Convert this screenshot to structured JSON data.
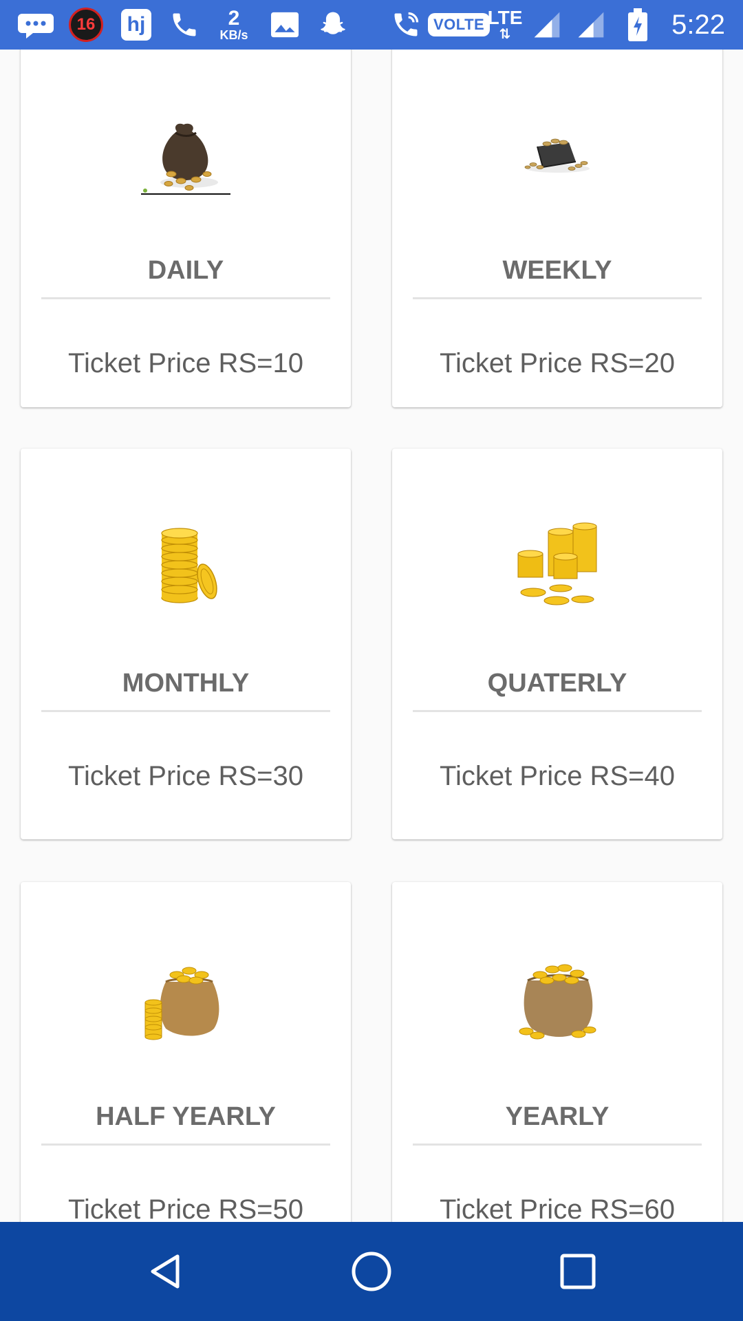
{
  "status_bar": {
    "time": "5:22",
    "notification_badge": "16",
    "hj_label": "hj",
    "network_speed_value": "2",
    "network_speed_unit": "KB/s",
    "volte_label": "VOLTE",
    "lte_label": "LTE",
    "lte_arrows": "⇅",
    "background_color": "#3b6fd6"
  },
  "plans": [
    {
      "title": "DAILY",
      "price": "Ticket Price RS=10",
      "icon": "money-sack-dark-icon"
    },
    {
      "title": "WEEKLY",
      "price": "Ticket Price RS=20",
      "icon": "wallet-coins-icon"
    },
    {
      "title": "MONTHLY",
      "price": "Ticket Price RS=30",
      "icon": "gold-coin-stack-icon"
    },
    {
      "title": "QUATERLY",
      "price": "Ticket Price RS=40",
      "icon": "gold-coin-stacks-icon"
    },
    {
      "title": "HALF YEARLY",
      "price": "Ticket Price RS=50",
      "icon": "gold-sack-icon"
    },
    {
      "title": "YEARLY",
      "price": "Ticket Price RS=60",
      "icon": "gold-sack-full-icon"
    }
  ],
  "nav_bar": {
    "background_color": "#0d47a1",
    "buttons": [
      "back-button",
      "home-button",
      "recents-button"
    ]
  }
}
